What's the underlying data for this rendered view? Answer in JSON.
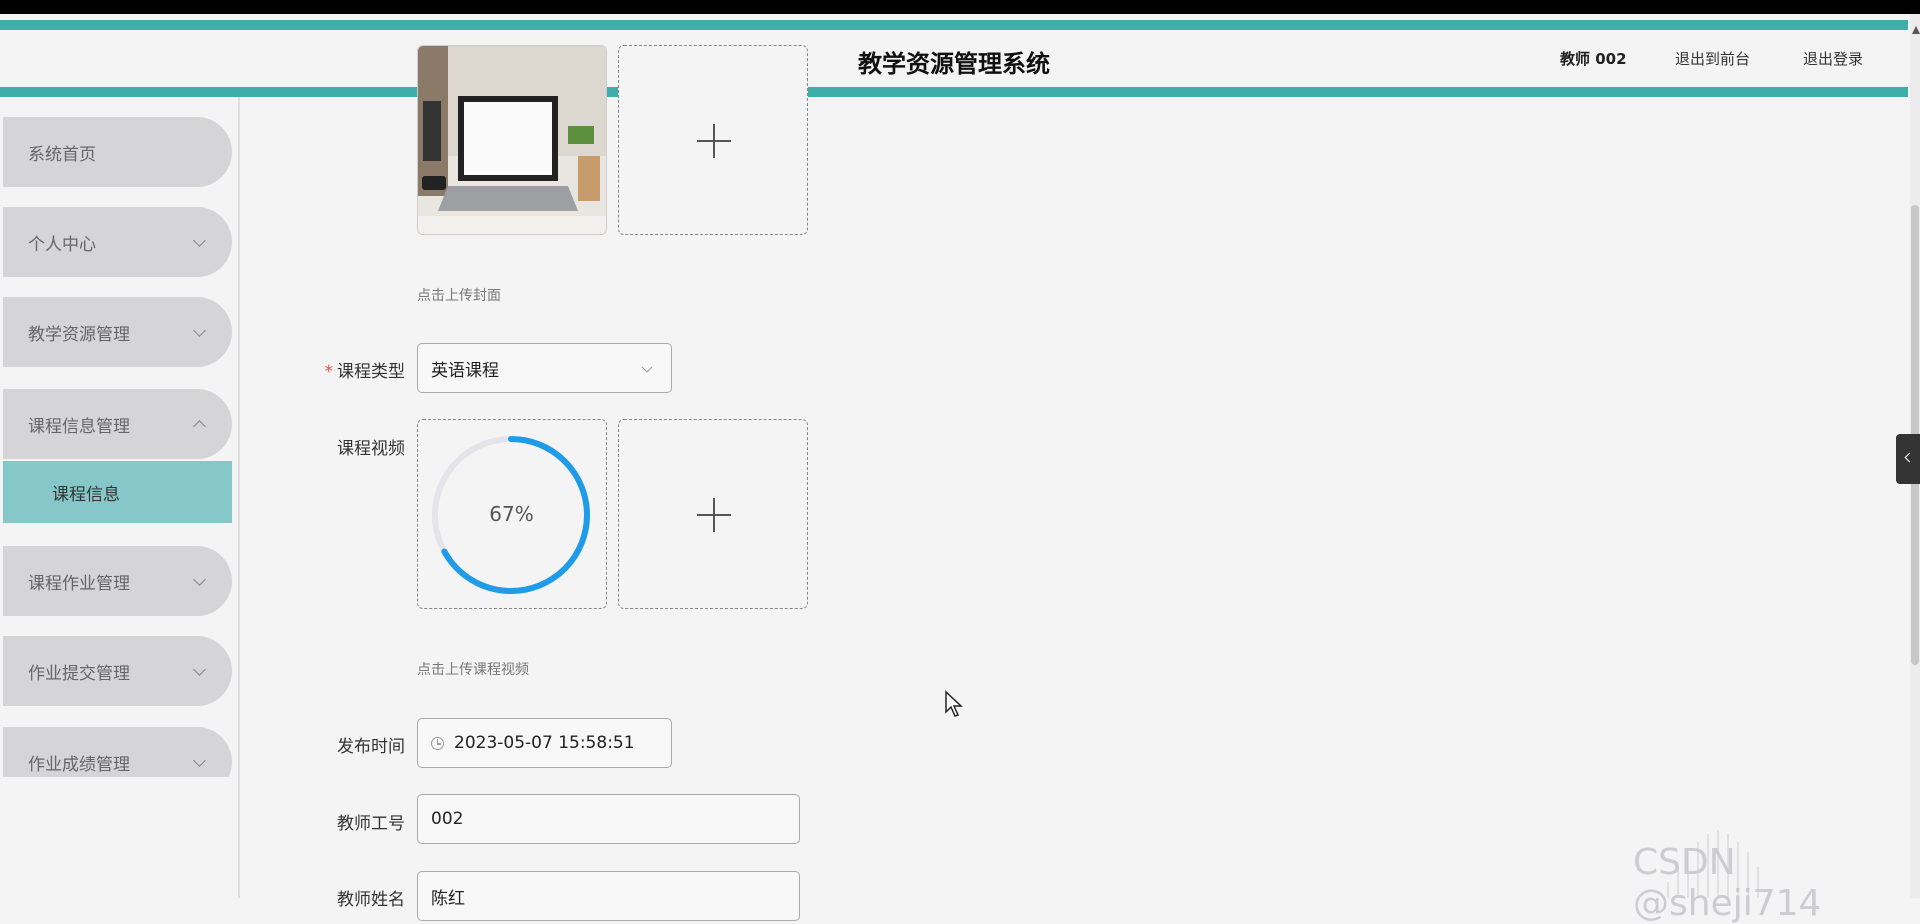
{
  "header": {
    "title": "教学资源管理系统",
    "user": "教师 002",
    "to_front": "退出到前台",
    "logout": "退出登录"
  },
  "sidebar": {
    "items": [
      {
        "label": "系统首页"
      },
      {
        "label": "个人中心"
      },
      {
        "label": "教学资源管理"
      },
      {
        "label": "课程信息管理"
      },
      {
        "label": "课程作业管理"
      },
      {
        "label": "作业提交管理"
      },
      {
        "label": "作业成绩管理"
      }
    ],
    "active_sub": "课程信息"
  },
  "form": {
    "cover_hint": "点击上传封面",
    "course_type_label": "课程类型",
    "course_type_value": "英语课程",
    "video_label": "课程视频",
    "video_progress": 67,
    "video_progress_text": "67%",
    "video_hint": "点击上传课程视频",
    "publish_time_label": "发布时间",
    "publish_time_value": "2023-05-07 15:58:51",
    "teacher_id_label": "教师工号",
    "teacher_id_value": "002",
    "teacher_name_label": "教师姓名",
    "teacher_name_value": "陈红"
  },
  "watermark": "CSDN @sheji714",
  "colors": {
    "accent": "#3eaeab",
    "active_menu": "#86c8c9",
    "progress": "#1f9be8",
    "required": "#e2504a"
  },
  "icons": [
    "plus-icon",
    "chevron-down-icon",
    "chevron-up-icon",
    "clock-icon",
    "chevron-left-icon",
    "cursor-icon"
  ]
}
